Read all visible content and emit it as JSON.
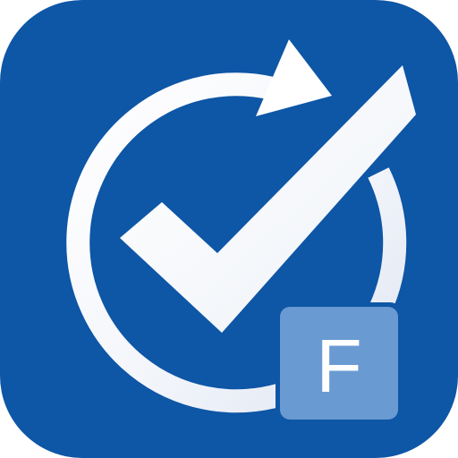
{
  "icon": {
    "badge_letter": "F",
    "symbol": "refresh-check-icon",
    "colors": {
      "background": "#0e56a6",
      "foreground": "#ffffff",
      "badge_fill": "#6a9ad2",
      "badge_border": "#0e56a6"
    }
  }
}
